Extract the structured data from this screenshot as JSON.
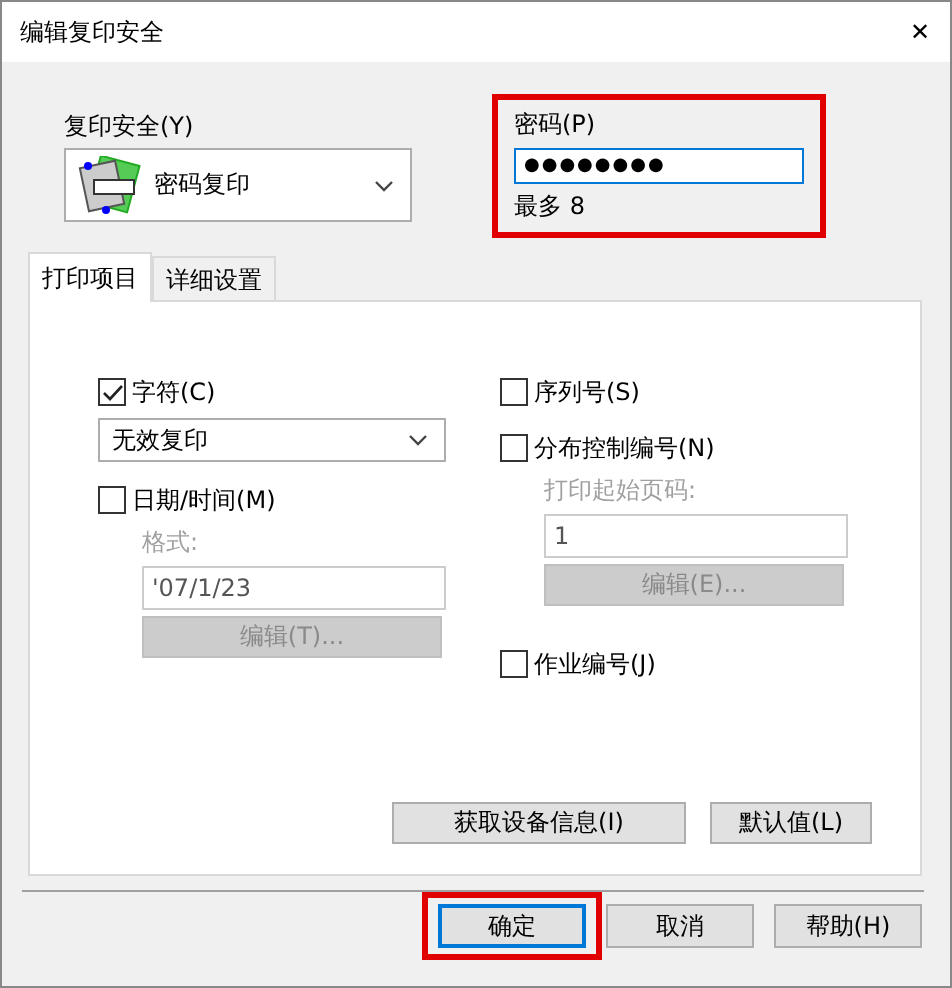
{
  "window": {
    "title": "编辑复印安全",
    "close": "✕"
  },
  "copy_security": {
    "label": "复印安全(Y)",
    "value": "密码复印"
  },
  "password": {
    "label": "密码(P)",
    "value": "●●●●●●●●",
    "hint": "最多 8",
    "highlighted": true
  },
  "tabs": [
    {
      "label": "打印项目",
      "selected": true
    },
    {
      "label": "详细设置",
      "selected": false
    }
  ],
  "left": {
    "character": {
      "label": "字符(C)",
      "checked": true,
      "value": "无效复印"
    },
    "datetime": {
      "label": "日期/时间(M)",
      "checked": false,
      "format_label": "格式:",
      "format_value": "'07/1/23",
      "edit": "编辑(T)...",
      "disabled": true
    }
  },
  "right": {
    "serial": {
      "label": "序列号(S)",
      "checked": false
    },
    "distribution": {
      "label": "分布控制编号(N)",
      "checked": false,
      "start_label": "打印起始页码:",
      "start_value": "1",
      "edit": "编辑(E)...",
      "disabled": true
    },
    "job": {
      "label": "作业编号(J)",
      "checked": false
    }
  },
  "panel_buttons": [
    "获取设备信息(I)",
    "默认值(L)"
  ],
  "footer_buttons": [
    {
      "label": "确定",
      "default": true,
      "highlighted": true
    },
    {
      "label": "取消",
      "default": false,
      "highlighted": false
    },
    {
      "label": "帮助(H)",
      "default": false,
      "highlighted": false
    }
  ]
}
